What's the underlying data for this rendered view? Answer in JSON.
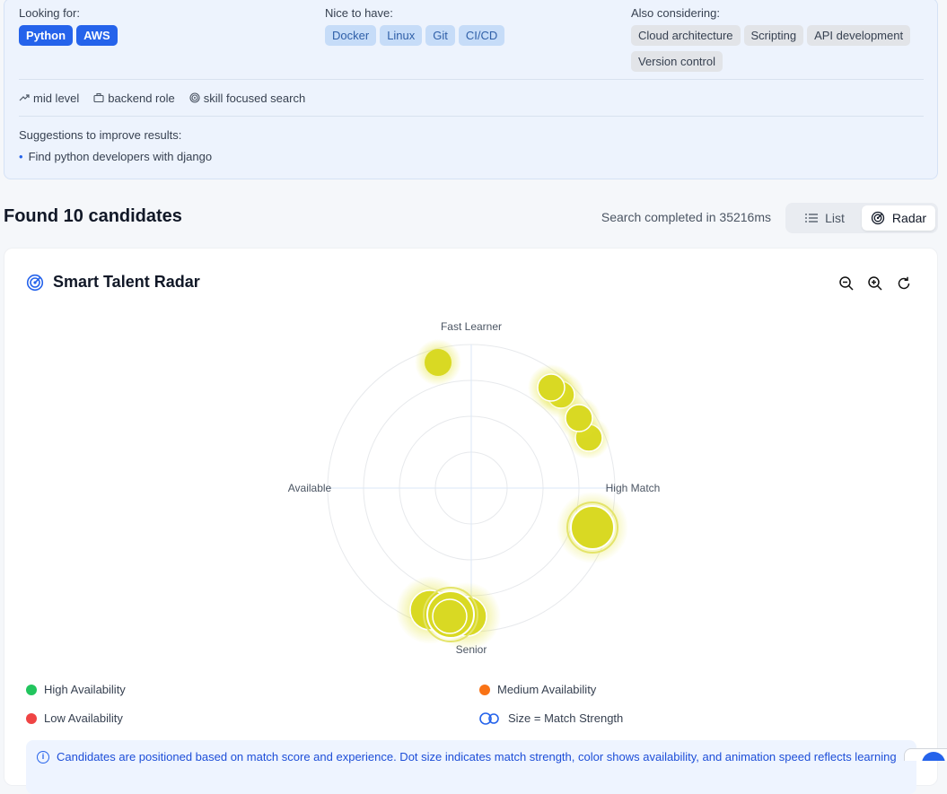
{
  "criteria": {
    "looking_for": {
      "label": "Looking for:",
      "chips": [
        "Python",
        "AWS"
      ]
    },
    "nice_to_have": {
      "label": "Nice to have:",
      "chips": [
        "Docker",
        "Linux",
        "Git",
        "CI/CD"
      ]
    },
    "also_considering": {
      "label": "Also considering:",
      "chips": [
        "Cloud architecture",
        "Scripting",
        "API development",
        "Version control"
      ]
    },
    "meta": [
      {
        "icon": "trend-up-icon",
        "text": "mid level"
      },
      {
        "icon": "briefcase-icon",
        "text": "backend role"
      },
      {
        "icon": "target-icon",
        "text": "skill focused search"
      }
    ],
    "suggestions_label": "Suggestions to improve results:",
    "suggestions": [
      "Find python developers with django"
    ]
  },
  "results": {
    "found_text": "Found 10 candidates",
    "search_time": "Search completed in 35216ms",
    "view_toggle": {
      "list_label": "List",
      "radar_label": "Radar",
      "active": "Radar"
    }
  },
  "radar": {
    "title": "Smart Talent Radar",
    "tools": [
      "zoom-out-icon",
      "zoom-in-icon",
      "refresh-icon"
    ],
    "axis_labels": {
      "top": "Fast Learner",
      "right": "High Match",
      "bottom": "Senior",
      "left": "Available"
    },
    "candidate_color": "#d9d923",
    "legend": [
      {
        "label": "High Availability",
        "color": "#22c55e"
      },
      {
        "label": "Medium Availability",
        "color": "#f97316"
      },
      {
        "label": "Low Availability",
        "color": "#ef4444"
      },
      {
        "label": "Size = Match Strength",
        "color": "#2563eb"
      }
    ],
    "note": "Candidates are positioned based on match score and experience. Dot size indicates match strength, color shows availability, and animation speed reflects learning"
  }
}
